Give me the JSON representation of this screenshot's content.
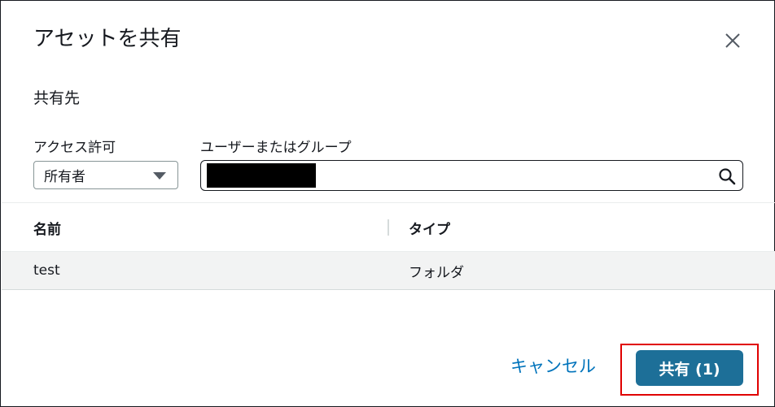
{
  "dialog": {
    "title": "アセットを共有",
    "close_icon": "close-icon"
  },
  "share_to": {
    "label": "共有先"
  },
  "access": {
    "label": "アクセス許可",
    "selected": "所有者",
    "caret_icon": "caret-down-icon"
  },
  "user_search": {
    "label": "ユーザーまたはグループ",
    "value": "",
    "search_icon": "search-icon",
    "redacted": true
  },
  "table": {
    "columns": [
      "名前",
      "タイプ"
    ],
    "rows": [
      {
        "name": "test",
        "type": "フォルダ"
      }
    ]
  },
  "footer": {
    "cancel_label": "キャンセル",
    "share_label": "共有 (1)"
  },
  "colors": {
    "primary_button": "#1d6f98",
    "link": "#0073bb",
    "highlight": "#e00000",
    "row_bg": "#f2f3f3"
  }
}
